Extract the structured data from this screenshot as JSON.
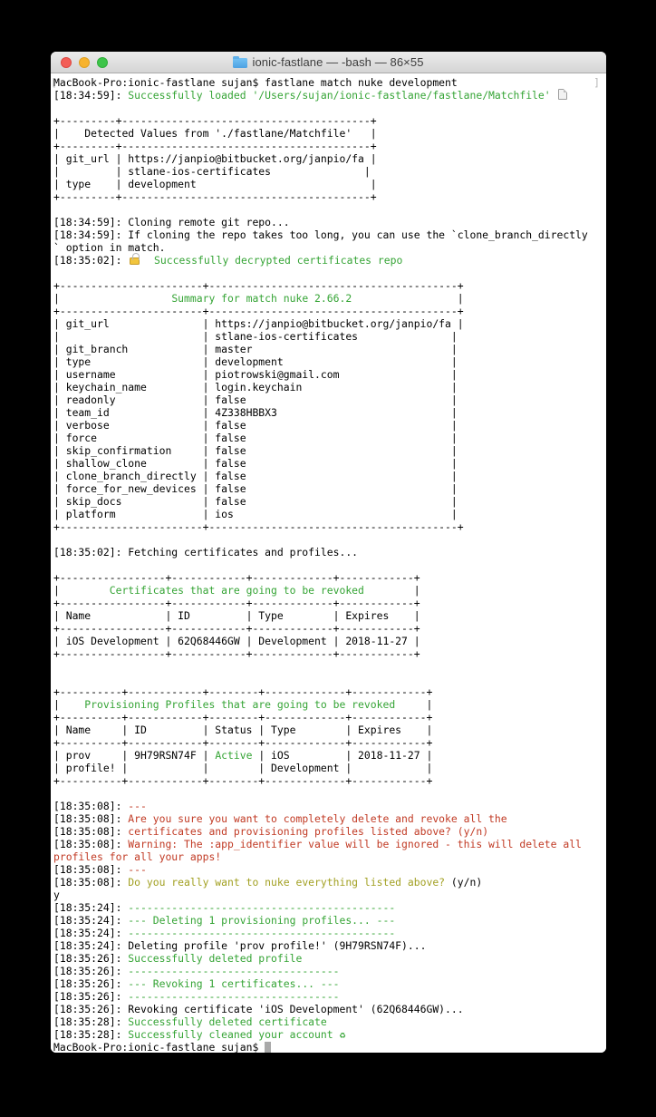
{
  "window": {
    "title": "ionic-fastlane — -bash — 86×55",
    "traffic_lights": [
      "close",
      "minimize",
      "zoom"
    ]
  },
  "colors": {
    "k": "#000000",
    "g": "#35a435",
    "r": "#c13a24",
    "y": "#a2a022",
    "mark": "#b7b7b7",
    "cursor": "#a9a9a9",
    "folder": "#5fb0ea",
    "titlebar_text": "#3d3d3d"
  },
  "terminal": {
    "mark_left": "[",
    "mark_right": "]",
    "lines": [
      {
        "m": true,
        "s": [
          {
            "t": "MacBook-Pro:ionic-fastlane sujan$ fastlane match nuke development"
          }
        ]
      },
      {
        "s": [
          {
            "t": "[18:34:59]: "
          },
          {
            "t": "Successfully loaded '/Users/sujan/ionic-fastlane/fastlane/Matchfile'",
            "c": "g"
          },
          {
            "t": " "
          },
          {
            "i": "page-icon"
          }
        ]
      },
      {
        "s": []
      },
      {
        "s": [
          {
            "t": "+---------+----------------------------------------+"
          }
        ]
      },
      {
        "s": [
          {
            "t": "|    "
          },
          {
            "t": "Detected Values from './fastlane/Matchfile'"
          },
          {
            "t": "   |"
          }
        ]
      },
      {
        "s": [
          {
            "t": "+---------+----------------------------------------+"
          }
        ]
      },
      {
        "s": [
          {
            "t": "| git_url | https://janpio@bitbucket.org/janpio/fa |"
          }
        ]
      },
      {
        "s": [
          {
            "t": "|         | stlane-ios-certificates               |"
          }
        ]
      },
      {
        "s": [
          {
            "t": "| type    | development                            |"
          }
        ]
      },
      {
        "s": [
          {
            "t": "+---------+----------------------------------------+"
          }
        ]
      },
      {
        "s": []
      },
      {
        "s": [
          {
            "t": "[18:34:59]: Cloning remote git repo..."
          }
        ]
      },
      {
        "s": [
          {
            "t": "[18:34:59]: If cloning the repo takes too long, you can use the `clone_branch_directly"
          }
        ]
      },
      {
        "s": [
          {
            "t": "` option in match."
          }
        ]
      },
      {
        "s": [
          {
            "t": "[18:35:02]: "
          },
          {
            "i": "lock-icon"
          },
          {
            "t": "  Successfully decrypted certificates repo",
            "c": "g"
          }
        ]
      },
      {
        "s": []
      },
      {
        "s": [
          {
            "t": "+-----------------------+----------------------------------------+"
          }
        ]
      },
      {
        "s": [
          {
            "t": "|                  "
          },
          {
            "t": "Summary for match nuke 2.66.2",
            "c": "g"
          },
          {
            "t": "                 |"
          }
        ]
      },
      {
        "s": [
          {
            "t": "+-----------------------+----------------------------------------+"
          }
        ]
      },
      {
        "s": [
          {
            "t": "| git_url               | https://janpio@bitbucket.org/janpio/fa |"
          }
        ]
      },
      {
        "s": [
          {
            "t": "|                       | stlane-ios-certificates               |"
          }
        ]
      },
      {
        "s": [
          {
            "t": "| git_branch            | master                                |"
          }
        ]
      },
      {
        "s": [
          {
            "t": "| type                  | development                           |"
          }
        ]
      },
      {
        "s": [
          {
            "t": "| username              | piotrowski@gmail.com                  |"
          }
        ]
      },
      {
        "s": [
          {
            "t": "| keychain_name         | login.keychain                        |"
          }
        ]
      },
      {
        "s": [
          {
            "t": "| readonly              | false                                 |"
          }
        ]
      },
      {
        "s": [
          {
            "t": "| team_id               | 4Z338HBBX3                            |"
          }
        ]
      },
      {
        "s": [
          {
            "t": "| verbose               | false                                 |"
          }
        ]
      },
      {
        "s": [
          {
            "t": "| force                 | false                                 |"
          }
        ]
      },
      {
        "s": [
          {
            "t": "| skip_confirmation     | false                                 |"
          }
        ]
      },
      {
        "s": [
          {
            "t": "| shallow_clone         | false                                 |"
          }
        ]
      },
      {
        "s": [
          {
            "t": "| clone_branch_directly | false                                 |"
          }
        ]
      },
      {
        "s": [
          {
            "t": "| force_for_new_devices | false                                 |"
          }
        ]
      },
      {
        "s": [
          {
            "t": "| skip_docs             | false                                 |"
          }
        ]
      },
      {
        "s": [
          {
            "t": "| platform              | ios                                   |"
          }
        ]
      },
      {
        "s": [
          {
            "t": "+-----------------------+----------------------------------------+"
          }
        ]
      },
      {
        "s": []
      },
      {
        "s": [
          {
            "t": "[18:35:02]: Fetching certificates and profiles..."
          }
        ]
      },
      {
        "s": []
      },
      {
        "s": [
          {
            "t": "+-----------------+------------+-------------+------------+"
          }
        ]
      },
      {
        "s": [
          {
            "t": "|        "
          },
          {
            "t": "Certificates that are going to be revoked",
            "c": "g"
          },
          {
            "t": "        |"
          }
        ]
      },
      {
        "s": [
          {
            "t": "+-----------------+------------+-------------+------------+"
          }
        ]
      },
      {
        "s": [
          {
            "t": "| Name            | ID         | Type        | Expires    |"
          }
        ]
      },
      {
        "s": [
          {
            "t": "+-----------------+------------+-------------+------------+"
          }
        ]
      },
      {
        "s": [
          {
            "t": "| iOS Development | 62Q68446GW | Development | 2018-11-27 |"
          }
        ]
      },
      {
        "s": [
          {
            "t": "+-----------------+------------+-------------+------------+"
          }
        ]
      },
      {
        "s": []
      },
      {
        "s": []
      },
      {
        "s": [
          {
            "t": "+----------+------------+--------+-------------+------------+"
          }
        ]
      },
      {
        "s": [
          {
            "t": "|    "
          },
          {
            "t": "Provisioning Profiles that are going to be revoked",
            "c": "g"
          },
          {
            "t": "     |"
          }
        ]
      },
      {
        "s": [
          {
            "t": "+----------+------------+--------+-------------+------------+"
          }
        ]
      },
      {
        "s": [
          {
            "t": "| Name     | ID         | Status | Type        | Expires    |"
          }
        ]
      },
      {
        "s": [
          {
            "t": "+----------+------------+--------+-------------+------------+"
          }
        ]
      },
      {
        "s": [
          {
            "t": "| prov     | 9H79RSN74F | "
          },
          {
            "t": "Active",
            "c": "g"
          },
          {
            "t": " | iOS         | 2018-11-27 |"
          }
        ]
      },
      {
        "s": [
          {
            "t": "| profile! |            |        | Development |            |"
          }
        ]
      },
      {
        "s": [
          {
            "t": "+----------+------------+--------+-------------+------------+"
          }
        ]
      },
      {
        "s": []
      },
      {
        "s": [
          {
            "t": "[18:35:08]: "
          },
          {
            "t": "---",
            "c": "r"
          }
        ]
      },
      {
        "s": [
          {
            "t": "[18:35:08]: "
          },
          {
            "t": "Are you sure you want to completely delete and revoke all the",
            "c": "r"
          }
        ]
      },
      {
        "s": [
          {
            "t": "[18:35:08]: "
          },
          {
            "t": "certificates and provisioning profiles listed above? (y/n)",
            "c": "r"
          }
        ]
      },
      {
        "s": [
          {
            "t": "[18:35:08]: "
          },
          {
            "t": "Warning: The :app_identifier value will be ignored - this will delete all",
            "c": "r"
          }
        ]
      },
      {
        "s": [
          {
            "t": "profiles for all your apps!",
            "c": "r"
          }
        ]
      },
      {
        "s": [
          {
            "t": "[18:35:08]: "
          },
          {
            "t": "---",
            "c": "r"
          }
        ]
      },
      {
        "s": [
          {
            "t": "[18:35:08]: "
          },
          {
            "t": "Do you really want to nuke everything listed above?",
            "c": "y"
          },
          {
            "t": " (y/n)"
          }
        ]
      },
      {
        "s": [
          {
            "t": "y"
          }
        ]
      },
      {
        "s": [
          {
            "t": "[18:35:24]: "
          },
          {
            "t": "-------------------------------------------",
            "c": "g"
          }
        ]
      },
      {
        "s": [
          {
            "t": "[18:35:24]: "
          },
          {
            "t": "--- Deleting 1 provisioning profiles... ---",
            "c": "g"
          }
        ]
      },
      {
        "s": [
          {
            "t": "[18:35:24]: "
          },
          {
            "t": "-------------------------------------------",
            "c": "g"
          }
        ]
      },
      {
        "s": [
          {
            "t": "[18:35:24]: Deleting profile 'prov profile!' (9H79RSN74F)..."
          }
        ]
      },
      {
        "s": [
          {
            "t": "[18:35:26]: "
          },
          {
            "t": "Successfully deleted profile",
            "c": "g"
          }
        ]
      },
      {
        "s": [
          {
            "t": "[18:35:26]: "
          },
          {
            "t": "----------------------------------",
            "c": "g"
          }
        ]
      },
      {
        "s": [
          {
            "t": "[18:35:26]: "
          },
          {
            "t": "--- Revoking 1 certificates... ---",
            "c": "g"
          }
        ]
      },
      {
        "s": [
          {
            "t": "[18:35:26]: "
          },
          {
            "t": "----------------------------------",
            "c": "g"
          }
        ]
      },
      {
        "s": [
          {
            "t": "[18:35:26]: Revoking certificate 'iOS Development' (62Q68446GW)..."
          }
        ]
      },
      {
        "s": [
          {
            "t": "[18:35:28]: "
          },
          {
            "t": "Successfully deleted certificate",
            "c": "g"
          }
        ]
      },
      {
        "s": [
          {
            "t": "[18:35:28]: "
          },
          {
            "t": "Successfully cleaned your account ",
            "c": "g"
          },
          {
            "t": "♻",
            "c": "g"
          }
        ]
      },
      {
        "cur": true,
        "s": [
          {
            "t": "MacBook-Pro:ionic-fastlane sujan$ "
          }
        ]
      }
    ]
  }
}
